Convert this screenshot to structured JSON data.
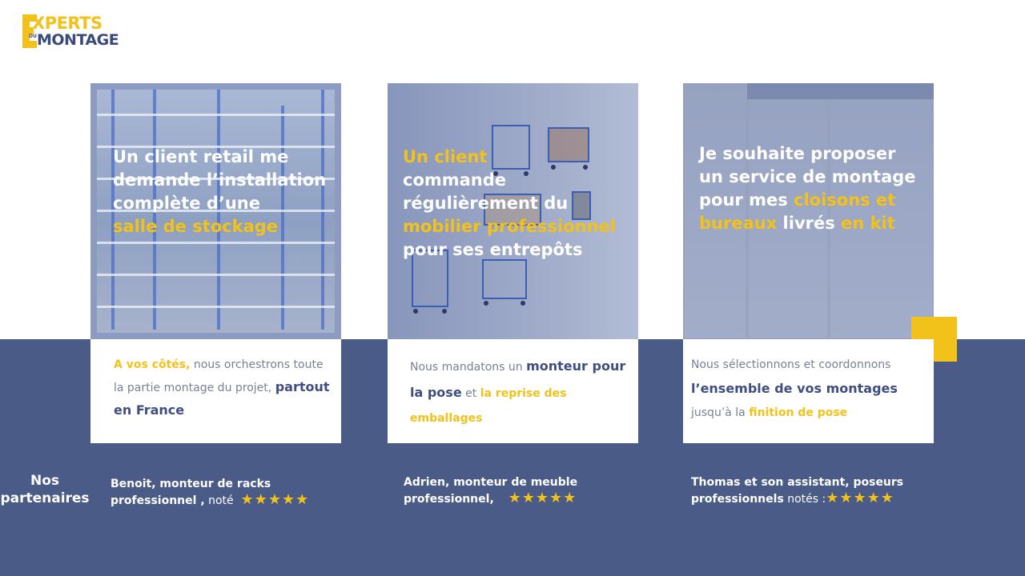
{
  "logo": {
    "top": "XPERTS",
    "du": "DU",
    "bottom": "MONTAGE"
  },
  "cards": [
    {
      "headline": {
        "l1": "Un client retail me",
        "l2": "demande l’installation",
        "l3": "complète d’une",
        "l4": "salle de stockage"
      },
      "text": {
        "y1": "A vos côtés,",
        "t1": " nous orchestrons toute la partie montage du projet, ",
        "b1": "partout en France"
      }
    },
    {
      "headline": {
        "l1": "Un client",
        "l2": "commande",
        "l3": "régulièrement du",
        "l4": "mobilier professionnel",
        "l5": "pour ses entrepôts"
      },
      "text": {
        "t1": "Nous mandatons un ",
        "b1": "monteur pour la pose",
        "t2": " et ",
        "y1": "la reprise des emballages"
      }
    },
    {
      "headline": {
        "l1": "Je souhaite proposer",
        "l2": "un service de montage",
        "l3a": "pour mes ",
        "l3b": "cloisons et",
        "l4a": "bureaux",
        "l4b": " livrés ",
        "l4c": "en kit"
      },
      "text": {
        "t1": "Nous sélectionnons et coordonnons ",
        "b1": "l’ensemble de vos montages",
        "t2": " jusqu’à la ",
        "y1": "finition de pose"
      }
    }
  ],
  "partners": {
    "heading_l1": "Nos",
    "heading_l2": "partenaires",
    "items": [
      {
        "l1": "Benoit, monteur de racks",
        "l2b": "professionnel ,",
        "l2t": " noté",
        "stars": "★★★★★"
      },
      {
        "l1": "Adrien, monteur de meuble",
        "l2b": "professionnel,",
        "l2t": "",
        "stars": "★★★★★"
      },
      {
        "l1": "Thomas et son assistant, poseurs",
        "l2b": "professionnels",
        "l2t": " notés :",
        "stars": "★★★★★"
      }
    ]
  },
  "colors": {
    "accent_yellow": "#f2c21a",
    "navy": "#4a5b88",
    "dark_blue_text": "#3f4e7e"
  }
}
